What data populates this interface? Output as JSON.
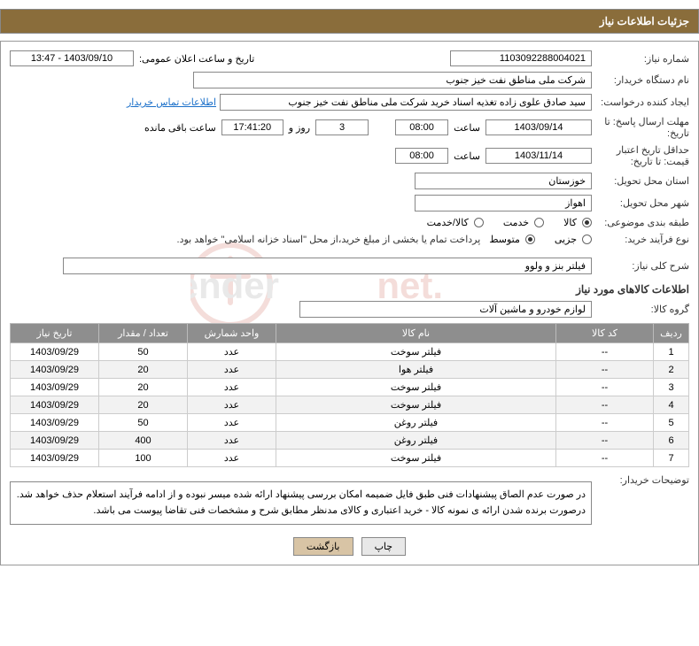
{
  "header": {
    "title": "جزئیات اطلاعات نیاز"
  },
  "fields": {
    "need_number_lbl": "شماره نیاز:",
    "need_number": "1103092288004021",
    "announce_dt_lbl": "تاریخ و ساعت اعلان عمومی:",
    "announce_dt": "1403/09/10 - 13:47",
    "buyer_org_lbl": "نام دستگاه خریدار:",
    "buyer_org": "شرکت ملی مناطق نفت خیز جنوب",
    "creator_lbl": "ایجاد کننده درخواست:",
    "creator": "سید صادق علوی زاده  تغذیه اسناد خرید  شرکت ملی مناطق نفت خیز جنوب",
    "contact_link": "اطلاعات تماس خریدار",
    "deadline_lbl": "مهلت ارسال پاسخ: تا تاریخ:",
    "deadline_date": "1403/09/14",
    "time_lbl": "ساعت",
    "deadline_time": "08:00",
    "days_left": "3",
    "days_and": "روز و",
    "time_left": "17:41:20",
    "remaining_lbl": "ساعت باقی مانده",
    "validity_lbl": "حداقل تاریخ اعتبار قیمت: تا تاریخ:",
    "validity_date": "1403/11/14",
    "validity_time": "08:00",
    "province_lbl": "استان محل تحویل:",
    "province": "خوزستان",
    "city_lbl": "شهر محل تحویل:",
    "city": "اهواز",
    "category_lbl": "طبقه بندی موضوعی:",
    "cat_goods": "کالا",
    "cat_service": "خدمت",
    "cat_both": "کالا/خدمت",
    "process_lbl": "نوع فرآیند خرید:",
    "proc_partial": "جزیی",
    "proc_medium": "متوسط",
    "proc_note": "پرداخت تمام یا بخشی از مبلغ خرید،از محل \"اسناد خزانه اسلامی\" خواهد بود.",
    "need_desc_lbl": "شرح کلی نیاز:",
    "need_desc": "فیلتر بنز و ولوو",
    "goods_section": "اطلاعات کالاهای مورد نیاز",
    "group_lbl": "گروه کالا:",
    "group": "لوازم خودرو و ماشین آلات",
    "buyer_notes_lbl": "توضیحات خریدار:",
    "buyer_notes_line1": "در صورت عدم الصاق پیشنهادات فنی طبق فایل ضمیمه امکان بررسی پیشنهاد ارائه شده میسر نبوده و از ادامه فرآیند استعلام حذف خواهد شد.",
    "buyer_notes_line2": "درصورت برنده شدن ارائه ی نمونه کالا - خرید اعتباری و کالای مدنظر مطابق شرح و مشخصات فنی تقاضا پیوست می باشد.",
    "btn_print": "چاپ",
    "btn_back": "بازگشت"
  },
  "table": {
    "headers": {
      "row": "ردیف",
      "code": "کد کالا",
      "name": "نام کالا",
      "unit": "واحد شمارش",
      "qty": "تعداد / مقدار",
      "date": "تاریخ نیاز"
    },
    "rows": [
      {
        "row": "1",
        "code": "--",
        "name": "فیلتر سوخت",
        "unit": "عدد",
        "qty": "50",
        "date": "1403/09/29"
      },
      {
        "row": "2",
        "code": "--",
        "name": "فیلتر هوا",
        "unit": "عدد",
        "qty": "20",
        "date": "1403/09/29"
      },
      {
        "row": "3",
        "code": "--",
        "name": "فیلتر سوخت",
        "unit": "عدد",
        "qty": "20",
        "date": "1403/09/29"
      },
      {
        "row": "4",
        "code": "--",
        "name": "فیلتر سوخت",
        "unit": "عدد",
        "qty": "20",
        "date": "1403/09/29"
      },
      {
        "row": "5",
        "code": "--",
        "name": "فیلتر روغن",
        "unit": "عدد",
        "qty": "50",
        "date": "1403/09/29"
      },
      {
        "row": "6",
        "code": "--",
        "name": "فیلتر روغن",
        "unit": "عدد",
        "qty": "400",
        "date": "1403/09/29"
      },
      {
        "row": "7",
        "code": "--",
        "name": "فیلتر سوخت",
        "unit": "عدد",
        "qty": "100",
        "date": "1403/09/29"
      }
    ]
  }
}
